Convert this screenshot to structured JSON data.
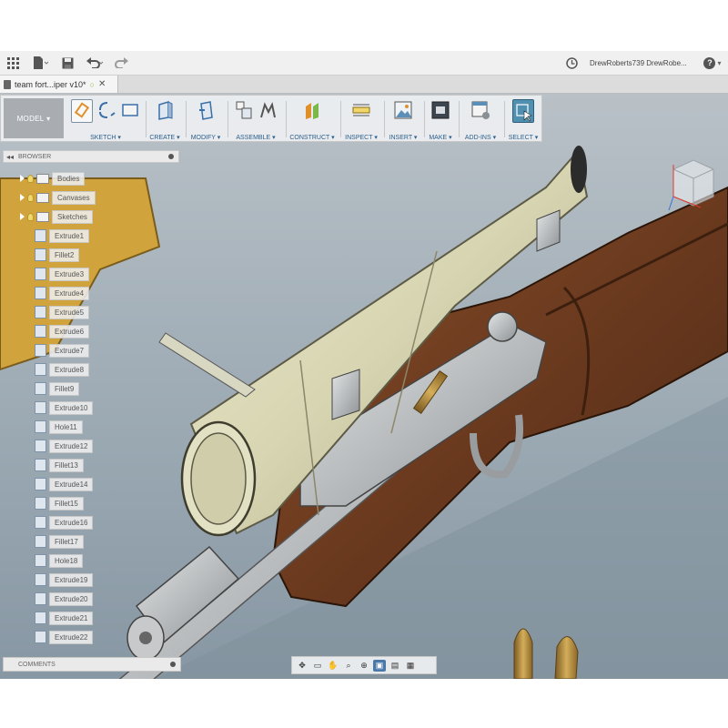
{
  "titlebar": {
    "user": "DrewRoberts739 DrewRobe...",
    "help_label": "?"
  },
  "tab": {
    "title": "team fort...iper v10*"
  },
  "ribbon": {
    "model_label": "MODEL",
    "groups": [
      "SKETCH",
      "CREATE",
      "MODIFY",
      "ASSEMBLE",
      "CONSTRUCT",
      "INSPECT",
      "INSERT",
      "MAKE",
      "ADD-INS",
      "SELECT"
    ]
  },
  "browser": {
    "title": "BROWSER",
    "folders": [
      "Bodies",
      "Canvases",
      "Sketches"
    ],
    "features": [
      "Extrude1",
      "Fillet2",
      "Extrude3",
      "Extrude4",
      "Extrude5",
      "Extrude6",
      "Extrude7",
      "Extrude8",
      "Fillet9",
      "Extrude10",
      "Hole11",
      "Extrude12",
      "Fillet13",
      "Extrude14",
      "Fillet15",
      "Extrude16",
      "Fillet17",
      "Hole18",
      "Extrude19",
      "Extrude20",
      "Extrude21",
      "Extrude22"
    ]
  },
  "comments": {
    "title": "COMMENTS"
  },
  "icons": [
    "grid-icon",
    "file-icon",
    "save-icon",
    "undo-icon",
    "redo-icon",
    "job-status-icon",
    "help-icon",
    "view-cube-icon"
  ],
  "colors": {
    "ribbon_bg": "#eceef0",
    "label_blue": "#2b5f8c",
    "scope_body": "#d8d6b5",
    "wood": "#6b3a1f",
    "metal": "#b9bcbe",
    "brass": "#b58a3a",
    "viewport_bg": "#9aa9b2"
  }
}
